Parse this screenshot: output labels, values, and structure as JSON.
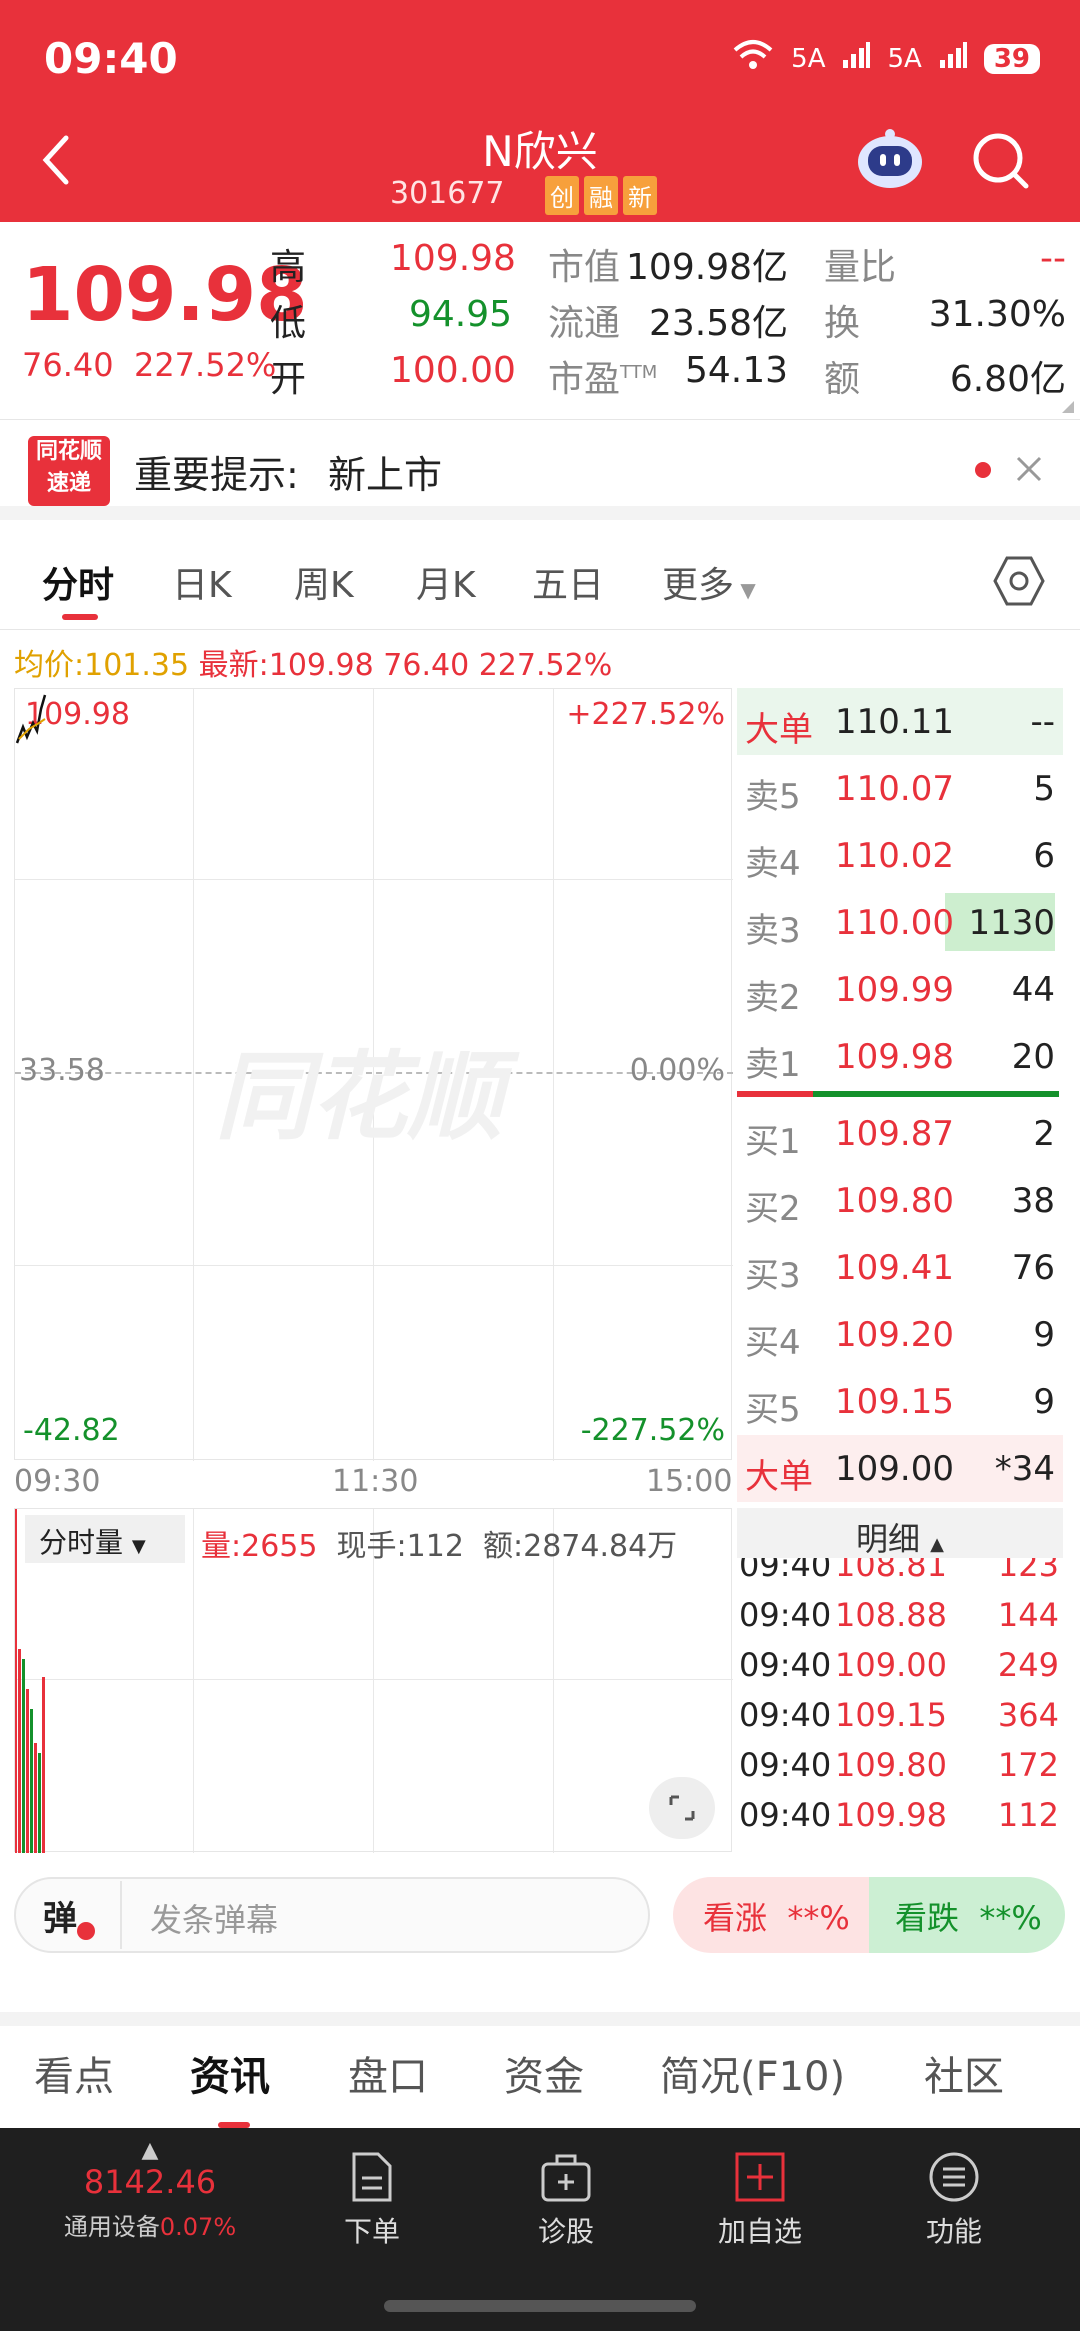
{
  "status": {
    "time": "09:40",
    "net1": "5A",
    "net2": "5A",
    "battery": "39"
  },
  "header": {
    "title": "N欣兴",
    "code": "301677",
    "tags": [
      "创",
      "融",
      "新"
    ]
  },
  "quote": {
    "price": "109.98",
    "change": "76.40",
    "change_pct": "227.52%",
    "high_label": "高",
    "high": "109.98",
    "low_label": "低",
    "low": "94.95",
    "open_label": "开",
    "open": "100.00",
    "mcap_label": "市值",
    "mcap": "109.98亿",
    "float_label": "流通",
    "float": "23.58亿",
    "pe_label": "市盈",
    "pe_sup": "TTM",
    "pe": "54.13",
    "vr_label": "量比",
    "vr": "--",
    "turnover_label": "换",
    "turnover": "31.30%",
    "amount_label": "额",
    "amount": "6.80亿"
  },
  "notice": {
    "logo_top": "同花顺",
    "logo_bottom": "速递",
    "label": "重要提示:",
    "text": "新上市"
  },
  "tabs": [
    "分时",
    "日K",
    "周K",
    "月K",
    "五日",
    "更多"
  ],
  "chart_stats": {
    "avg_label": "均价:",
    "avg": "101.35",
    "latest_label": "最新:",
    "latest": "109.98",
    "change": "76.40",
    "pct": "227.52%"
  },
  "chart": {
    "y_top": "109.98",
    "y_mid": "33.58",
    "y_bottom": "-42.82",
    "pct_top": "+227.52%",
    "pct_mid": "0.00%",
    "pct_bottom": "-227.52%",
    "x_labels": [
      "09:30",
      "11:30",
      "15:00"
    ],
    "watermark": "同花顺",
    "volume_tab": "分时量",
    "vol_label": "量:",
    "vol": "2655",
    "hand_label": "现手:",
    "hand": "112",
    "amt_label": "额:",
    "amt": "2874.84万"
  },
  "orderbook": {
    "big_sell": {
      "label": "大单",
      "price": "110.11",
      "vol": "--"
    },
    "asks": [
      {
        "label": "卖5",
        "price": "110.07",
        "vol": "5"
      },
      {
        "label": "卖4",
        "price": "110.02",
        "vol": "6"
      },
      {
        "label": "卖3",
        "price": "110.00",
        "vol": "1130"
      },
      {
        "label": "卖2",
        "price": "109.99",
        "vol": "44"
      },
      {
        "label": "卖1",
        "price": "109.98",
        "vol": "20"
      }
    ],
    "bids": [
      {
        "label": "买1",
        "price": "109.87",
        "vol": "2"
      },
      {
        "label": "买2",
        "price": "109.80",
        "vol": "38"
      },
      {
        "label": "买3",
        "price": "109.41",
        "vol": "76"
      },
      {
        "label": "买4",
        "price": "109.20",
        "vol": "9"
      },
      {
        "label": "买5",
        "price": "109.15",
        "vol": "9"
      }
    ],
    "big_buy": {
      "label": "大单",
      "price": "109.00",
      "vol": "*34"
    },
    "detail_label": "明细",
    "ticks": [
      {
        "time": "09:40",
        "price": "108.81",
        "vol": "123"
      },
      {
        "time": "09:40",
        "price": "108.88",
        "vol": "144"
      },
      {
        "time": "09:40",
        "price": "109.00",
        "vol": "249"
      },
      {
        "time": "09:40",
        "price": "109.15",
        "vol": "364"
      },
      {
        "time": "09:40",
        "price": "109.80",
        "vol": "172"
      },
      {
        "time": "09:40",
        "price": "109.98",
        "vol": "112"
      }
    ]
  },
  "danmu": {
    "icon": "弹",
    "placeholder": "发条弹幕"
  },
  "sentiment": {
    "up_label": "看涨",
    "up_val": "**%",
    "down_label": "看跌",
    "down_val": "**%"
  },
  "bottom_tabs": [
    "看点",
    "资讯",
    "盘口",
    "资金",
    "简况(F10)",
    "社区"
  ],
  "nav": {
    "index_value": "8142.46",
    "index_name": "通用设备",
    "index_pct": "0.07%",
    "items": [
      "下单",
      "诊股",
      "加自选",
      "功能"
    ]
  }
}
